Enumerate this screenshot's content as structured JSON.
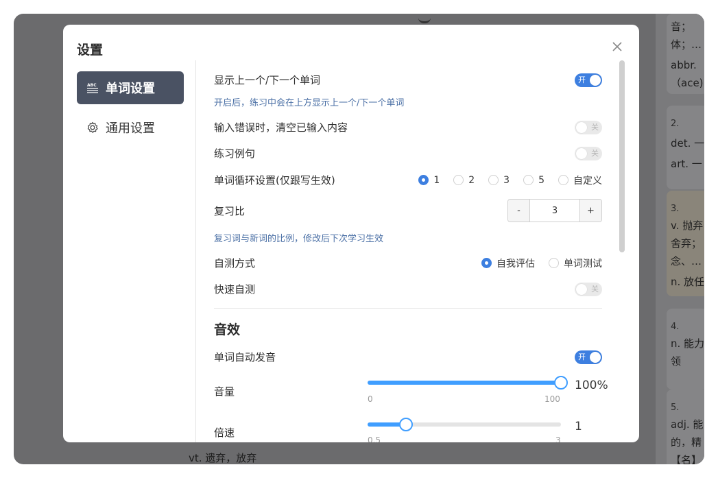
{
  "background": {
    "cards": [
      {
        "lines": [
          "音；",
          "体；…",
          "abbr.",
          "（ace)"
        ]
      },
      {
        "lines": [
          "2.",
          "det. 一",
          "art. 一"
        ]
      },
      {
        "lines": [
          "3.",
          "v. 抛弃",
          "舍弃；",
          "念、…",
          "n. 放任"
        ]
      },
      {
        "lines": [
          "4.",
          "n. 能力",
          "领"
        ]
      },
      {
        "lines": [
          "5.",
          "adj. 能",
          "的，精",
          "【名】"
        ]
      }
    ],
    "bottom_text": "vt.      遗弃，放弃"
  },
  "dialog": {
    "title": "设置",
    "close_icon": "close-icon",
    "sidebar": [
      {
        "label": "单词设置",
        "icon": "abc-list-icon",
        "active": true
      },
      {
        "label": "通用设置",
        "icon": "gear-icon",
        "active": false
      }
    ],
    "settings": {
      "show_prev_next": {
        "label": "显示上一个/下一个单词",
        "hint": "开启后，练习中会在上方显示上一个/下一个单词",
        "state": "开"
      },
      "clear_on_error": {
        "label": "输入错误时，清空已输入内容",
        "state": "关"
      },
      "practice_sentence": {
        "label": "练习例句",
        "state": "关"
      },
      "loop": {
        "label": "单词循环设置(仅跟写生效)",
        "options": [
          "1",
          "2",
          "3",
          "5",
          "自定义"
        ],
        "selected": "1"
      },
      "review_ratio": {
        "label": "复习比",
        "minus": "-",
        "value": "3",
        "plus": "+",
        "hint": "复习词与新词的比例，修改后下次学习生效"
      },
      "self_test": {
        "label": "自测方式",
        "options": [
          "自我评估",
          "单词测试"
        ],
        "selected": "自我评估"
      },
      "quick_test": {
        "label": "快速自测",
        "state": "关"
      }
    },
    "sound": {
      "section_title": "音效",
      "auto_pronounce": {
        "label": "单词自动发音",
        "state": "开"
      },
      "volume": {
        "label": "音量",
        "min": "0",
        "max": "100",
        "value_text": "100%",
        "value": 100
      },
      "speed": {
        "label": "倍速",
        "min": "0.5",
        "max": "3",
        "value_text": "1",
        "value": 1
      }
    },
    "colors": {
      "accent": "#409eff",
      "sidebar_active": "#4a5263",
      "hint": "#4a6fa5"
    }
  }
}
